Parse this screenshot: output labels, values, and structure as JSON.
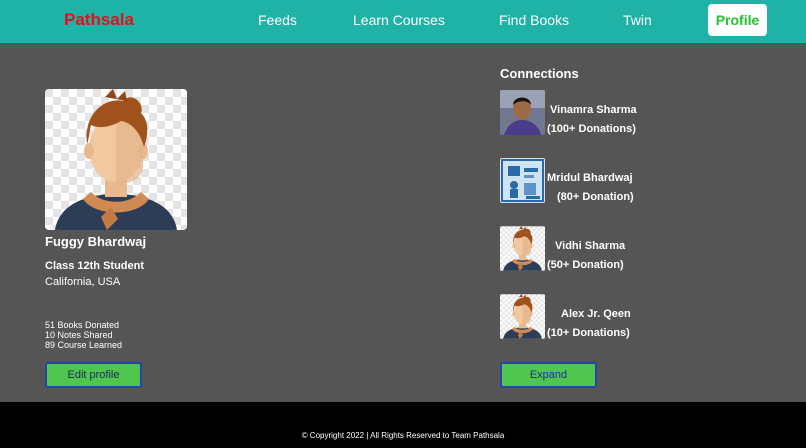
{
  "nav": {
    "brand": "Pathsala",
    "links": [
      "Feeds",
      "Learn Courses",
      "Find Books",
      "Twin"
    ],
    "active": "Profile"
  },
  "profile": {
    "name": "Fuggy Bhardwaj",
    "class": "Class 12th Student",
    "location": "California, USA",
    "stats": [
      "51 Books Donated",
      "10 Notes Shared",
      "89 Course Learned"
    ],
    "edit_label": "Edit profile"
  },
  "connections": {
    "title": "Connections",
    "items": [
      {
        "name": "Vinamra Sharma",
        "donations": "(100+ Donations)"
      },
      {
        "name": "Mridul Bhardwaj",
        "donations": "(80+ Donation)"
      },
      {
        "name": "Vidhi Sharma",
        "donations": "(50+ Donation)"
      },
      {
        "name": "Alex Jr. Qeen",
        "donations": "(10+ Donations)"
      }
    ],
    "expand_label": "Expand"
  },
  "footer": {
    "copyright": "© Copyright 2022 | All Rights Reserved to Team Pathsala"
  },
  "colors": {
    "navbar": "#1fb2a6",
    "brand": "#e0131b",
    "active": "#22c22e",
    "button": "#4fc74f",
    "page_bg": "#555555"
  }
}
